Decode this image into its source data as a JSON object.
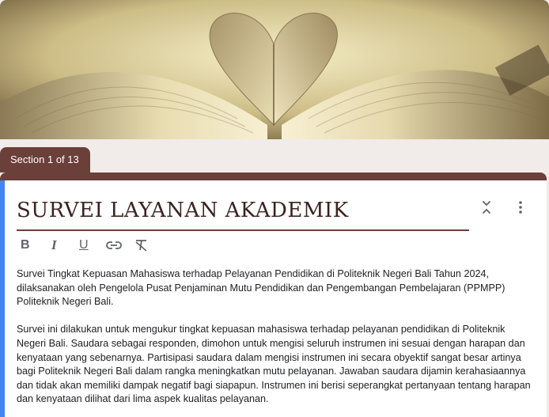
{
  "header": {
    "image_icon": "open-book-heart-image"
  },
  "section": {
    "tab_label": "Section 1 of 13"
  },
  "card": {
    "title": "SURVEI LAYANAN AKADEMIK",
    "collapse_icon": "collapse-icon",
    "more_icon": "more-vert-icon",
    "toolbar": {
      "bold_label": "B",
      "italic_label": "I",
      "underline_label": "U",
      "link_icon": "link-icon",
      "clear_format_icon": "clear-format-icon"
    },
    "description": {
      "paragraph_1": "Survei Tingkat Kepuasan Mahasiswa terhadap Pelayanan Pendidikan di Politeknik Negeri Bali Tahun 2024, dilaksanakan oleh Pengelola Pusat Penjaminan Mutu Pendidikan dan Pengembangan Pembelajaran (PPMPP) Politeknik Negeri Bali.",
      "paragraph_2": "Survei ini dilakukan untuk mengukur tingkat kepuasan mahasiswa terhadap pelayanan pendidikan di Politeknik Negeri Bali. Saudara sebagai responden, dimohon untuk mengisi seluruh instrumen ini sesuai dengan harapan dan kenyataan yang sebenarnya. Partisipasi saudara dalam mengisi instrumen ini secara obyektif sangat besar artinya bagi Politeknik Negeri Bali dalam rangka meningkatkan mutu pelayanan. Jawaban saudara dijamin kerahasiaannya dan tidak akan memiliki dampak negatif bagi siapapun. Instrumen ini berisi seperangkat pertanyaan tentang harapan dan kenyataan dilihat dari lima aspek kualitas pelayanan."
    }
  },
  "colors": {
    "theme": "#6b3f3a",
    "accent": "#4285f4",
    "page_background": "#f1ece9"
  }
}
